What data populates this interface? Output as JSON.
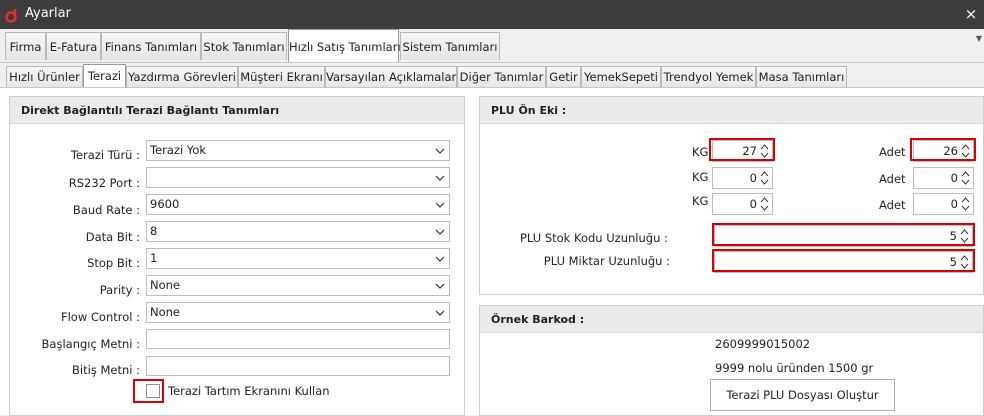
{
  "window": {
    "title": "Ayarlar",
    "close_glyph": "×"
  },
  "main_tabs": [
    {
      "label": "Firma"
    },
    {
      "label": "E-Fatura"
    },
    {
      "label": "Finans Tanımları"
    },
    {
      "label": "Stok Tanımları"
    },
    {
      "label": "Hızlı Satış Tanımları",
      "active": true
    },
    {
      "label": "Sistem Tanımları"
    }
  ],
  "sub_tabs": [
    {
      "label": "Hızlı Ürünler"
    },
    {
      "label": "Terazi",
      "active": true
    },
    {
      "label": "Yazdırma Görevleri"
    },
    {
      "label": "Müşteri Ekranı"
    },
    {
      "label": "Varsayılan Açıklamalar"
    },
    {
      "label": "Diğer Tanımlar"
    },
    {
      "label": "Getir"
    },
    {
      "label": "YemekSepeti"
    },
    {
      "label": "Trendyol Yemek"
    },
    {
      "label": "Masa Tanımları"
    }
  ],
  "scale_group": {
    "title": "Direkt Bağlantılı Terazi Bağlantı Tanımları",
    "fields": [
      {
        "label": "Terazi Türü :",
        "value": "Terazi Yok"
      },
      {
        "label": "RS232 Port :",
        "value": ""
      },
      {
        "label": "Baud Rate :",
        "value": "9600"
      },
      {
        "label": "Data Bit :",
        "value": "8"
      },
      {
        "label": "Stop Bit :",
        "value": "1"
      },
      {
        "label": "Parity :",
        "value": "None"
      },
      {
        "label": "Flow Control :",
        "value": "None"
      }
    ],
    "start_text_label": "Başlangıç Metni :",
    "start_text_value": "",
    "end_text_label": "Bitiş Metni :",
    "end_text_value": "",
    "tare_checkbox_label": "Terazi Tartım Ekranını Kullan",
    "tare_checkbox_checked": false
  },
  "plu_group": {
    "title": "PLU Ön Eki :",
    "rows": [
      {
        "kg_label": "KG",
        "kg_value": "27",
        "adet_label": "Adet",
        "adet_value": "26"
      },
      {
        "kg_label": "KG",
        "kg_value": "0",
        "adet_label": "Adet",
        "adet_value": "0"
      },
      {
        "kg_label": "KG",
        "kg_value": "0",
        "adet_label": "Adet",
        "adet_value": "0"
      }
    ],
    "stock_code_length_label": "PLU Stok Kodu Uzunluğu :",
    "stock_code_length_value": "5",
    "quantity_length_label": "PLU Miktar Uzunluğu :",
    "quantity_length_value": "5"
  },
  "barcode_group": {
    "title": "Örnek Barkod :",
    "barcode": "2609999015002",
    "description": "9999 nolu üründen 1500 gr",
    "create_button_label": "Terazi PLU Dosyası Oluştur"
  },
  "colors": {
    "titlebar": "#3d3d3d",
    "highlight": "#d90000",
    "app_icon": "#e03030"
  }
}
